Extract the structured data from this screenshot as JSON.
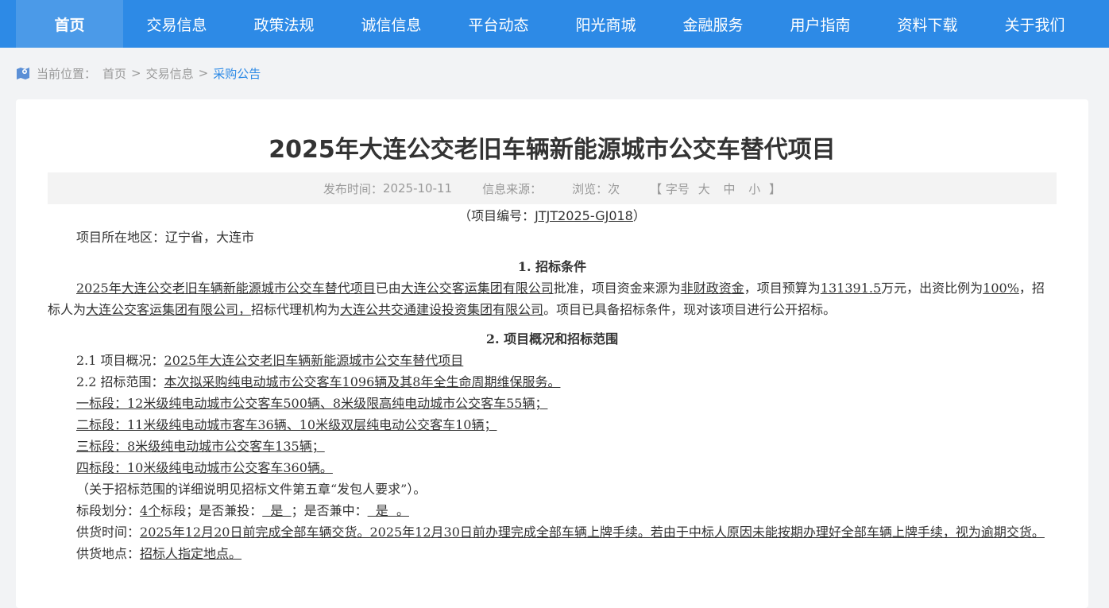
{
  "nav": {
    "items": [
      "首页",
      "交易信息",
      "政策法规",
      "诚信信息",
      "平台动态",
      "阳光商城",
      "金融服务",
      "用户指南",
      "资料下载",
      "关于我们"
    ],
    "active_index": 0
  },
  "breadcrumb": {
    "prefix": "当前位置：",
    "home": "首页",
    "sep": ">",
    "section": "交易信息",
    "current": "采购公告"
  },
  "article": {
    "title": "2025年大连公交老旧车辆新能源城市公交车替代项目",
    "meta": {
      "publish_label": "发布时间：",
      "publish_date": "2025-10-11",
      "source_label": "信息来源：",
      "views_label": "浏览：次",
      "font_open": "【 字号",
      "font_large": "大",
      "font_medium": "中",
      "font_small": "小",
      "font_close": "】"
    },
    "project_no_prefix": "（项目编号：",
    "project_no": "JTJT2025-GJ018",
    "project_no_suffix": "）",
    "region": "项目所在地区：辽宁省，大连市",
    "section1_title": "1. 招标条件",
    "s1": {
      "project_name": "2025年大连公交老旧车辆新能源城市公交车替代项目",
      "t1": "已由",
      "approver": "大连公交客运集团有限公司",
      "t2": "批准，项目资金来源为",
      "fund": "非财政资金",
      "t3": "，项目预算为",
      "budget": "131391.5",
      "t4": "万元，出资比例为",
      "ratio": "100%",
      "t5": "，招标人为",
      "tenderer": "大连公交客运集团有限公司，",
      "t6": "招标代理机构为",
      "agent": "大连公共交通建设投资集团有限公司",
      "t7": "。项目已具备招标条件，现对该项目进行公开招标。"
    },
    "section2_title": "2. 项目概况和招标范围",
    "s2": {
      "overview_label": "2.1  项目概况：",
      "overview": "2025年大连公交老旧车辆新能源城市公交车替代项目",
      "scope_label": "2.2  招标范围：",
      "scope": "本次拟采购纯电动城市公交客车1096辆及其8年全生命周期维保服务。",
      "lot1": "一标段：12米级纯电动城市公交客车500辆、8米级限高纯电动城市公交客车55辆；",
      "lot2": "二标段：11米级纯电动城市客车36辆、10米级双层纯电动公交客车10辆；",
      "lot3": "三标段：8米级纯电动城市公交客车135辆；",
      "lot4": "四标段：10米级纯电动城市公交客车360辆。",
      "note": "（关于招标范围的详细说明见招标文件第五章“发包人要求”）。",
      "division_label": "标段划分：",
      "division_value": "4个",
      "division_t1": "标段；是否兼投：",
      "joint_bid": "  是  ",
      "division_t2": "；是否兼中：",
      "joint_win": "  是  。",
      "supply_time_label": "供货时间：",
      "supply_time": "2025年12月20日前完成全部车辆交货。2025年12月30日前办理完成全部车辆上牌手续。若由于中标人原因未能按期办理好全部车辆上牌手续，视为逾期交货。",
      "supply_place_label": "供货地点：",
      "supply_place": "招标人指定地点。"
    }
  },
  "colors": {
    "nav_bg": "#2d8ae6",
    "nav_active_bg": "#4b9ae8",
    "link_current": "#2d8ae6",
    "page_bg": "#f2f3f5"
  },
  "icons": {
    "breadcrumb": "location-map-icon"
  }
}
